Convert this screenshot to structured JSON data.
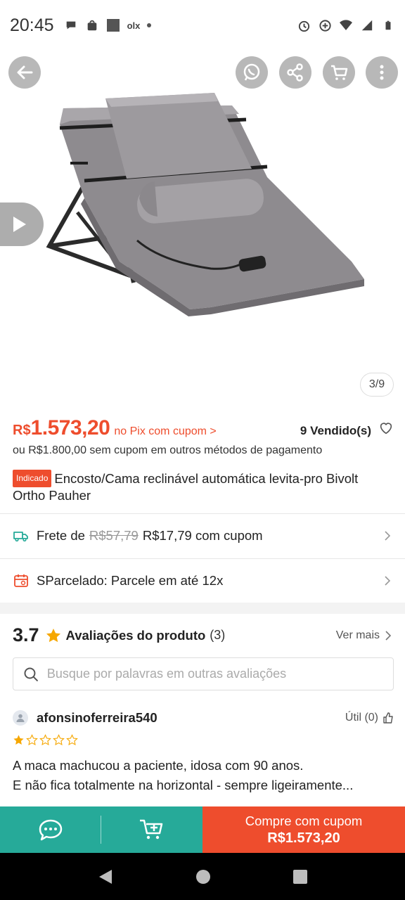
{
  "status_bar": {
    "time": "20:45",
    "carrier_icon_text": "olx",
    "left_icons": [
      "chat-bubble-icon",
      "shopee-bag-icon",
      "square-app-icon",
      "olx-icon",
      "dot-icon"
    ],
    "right_icons": [
      "alarm-icon",
      "data-saver-icon",
      "wifi-icon",
      "signal-icon",
      "battery-icon"
    ]
  },
  "gallery": {
    "image_counter": "3/9",
    "top_buttons": [
      "back-arrow-icon",
      "whatsapp-icon",
      "share-icon",
      "cart-icon",
      "more-vertical-icon"
    ]
  },
  "product": {
    "currency": "R$",
    "price": "1.573,20",
    "pix_label": "no Pix com cupom >",
    "sold": "9 Vendido(s)",
    "alt_price": "ou R$1.800,00 sem cupom em outros métodos de pagamento",
    "badge": "Indicado",
    "title": "Encosto/Cama reclinável automática levita-pro Bivolt Ortho Pauher"
  },
  "shipping": {
    "label": "Frete de",
    "old_price": "R$57,79",
    "new_price": "R$17,79 com cupom"
  },
  "installments": {
    "label": "SParcelado: Parcele em até 12x"
  },
  "reviews": {
    "score": "3.7",
    "title": "Avaliações do produto",
    "count": "(3)",
    "see_more": "Ver mais",
    "search_placeholder": "Busque por palavras em outras avaliações",
    "items": [
      {
        "username": "afonsinoferreira540",
        "useful": "Útil (0)",
        "rating": 1,
        "line1": "A maca machucou a paciente, idosa com 90 anos.",
        "line2": "E não fica totalmente na horizontal - sempre ligeiramente..."
      }
    ]
  },
  "bottom_bar": {
    "buy_label": "Compre com cupom",
    "buy_price": "R$1.573,20"
  },
  "colors": {
    "primary": "#ee4d2d",
    "teal": "#26aa99",
    "star": "#f6a700"
  }
}
